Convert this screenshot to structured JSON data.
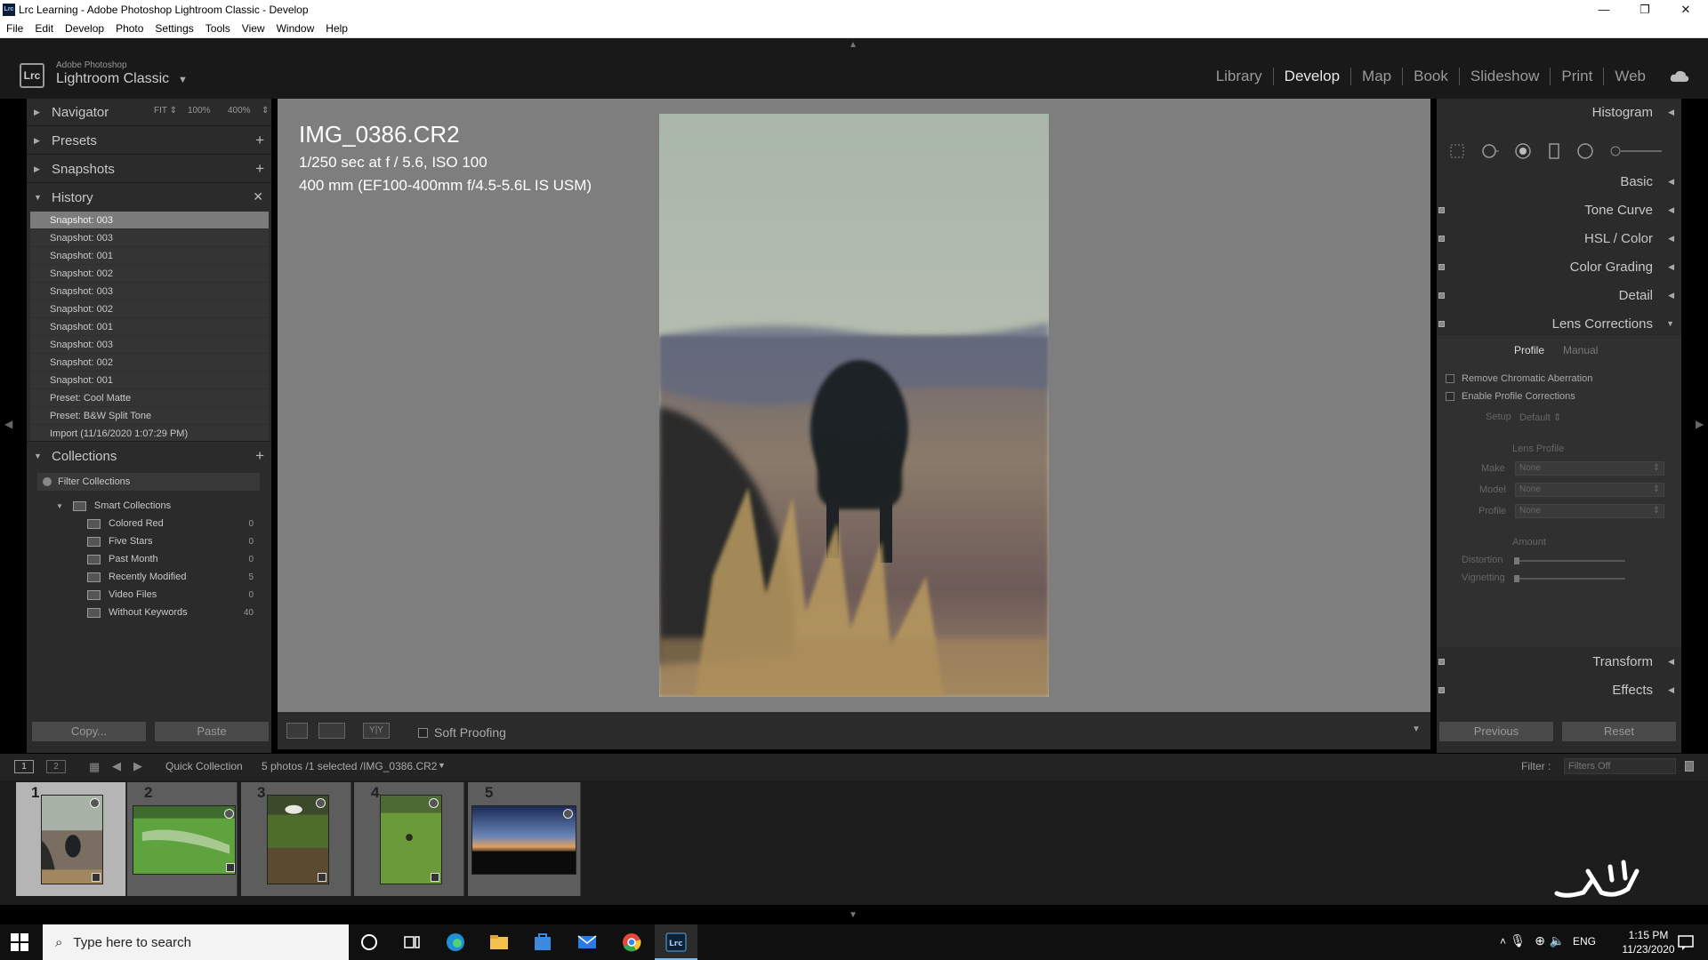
{
  "window": {
    "title": "Lrc Learning - Adobe Photoshop Lightroom Classic - Develop",
    "app_icon_text": "Lrc",
    "minimize": "—",
    "maximize": "❐",
    "close": "✕"
  },
  "menu": [
    "File",
    "Edit",
    "Develop",
    "Photo",
    "Settings",
    "Tools",
    "View",
    "Window",
    "Help"
  ],
  "brand": {
    "logo": "Lrc",
    "small": "Adobe Photoshop",
    "large": "Lightroom Classic"
  },
  "modules": [
    "Library",
    "Develop",
    "Map",
    "Book",
    "Slideshow",
    "Print",
    "Web"
  ],
  "active_module": "Develop",
  "left_panel": {
    "navigator": {
      "label": "Navigator",
      "fit": "FIT ⇕",
      "z100": "100%",
      "z400": "400%",
      "more": "⇕"
    },
    "presets": {
      "label": "Presets"
    },
    "snapshots": {
      "label": "Snapshots"
    },
    "history": {
      "label": "History",
      "items": [
        "Snapshot: 003",
        "Snapshot: 003",
        "Snapshot: 001",
        "Snapshot: 002",
        "Snapshot: 003",
        "Snapshot: 002",
        "Snapshot: 001",
        "Snapshot: 003",
        "Snapshot: 002",
        "Snapshot: 001",
        "Preset: Cool Matte",
        "Preset: B&W Split Tone",
        "Import (11/16/2020 1:07:29 PM)"
      ],
      "selected_index": 0
    },
    "collections": {
      "label": "Collections",
      "filter": "Filter Collections",
      "group": "Smart Collections",
      "items": [
        {
          "name": "Colored Red",
          "count": "0"
        },
        {
          "name": "Five Stars",
          "count": "0"
        },
        {
          "name": "Past Month",
          "count": "0"
        },
        {
          "name": "Recently Modified",
          "count": "5"
        },
        {
          "name": "Video Files",
          "count": "0"
        },
        {
          "name": "Without Keywords",
          "count": "40"
        }
      ]
    },
    "copy_button": "Copy...",
    "paste_button": "Paste"
  },
  "image_info": {
    "filename": "IMG_0386.CR2",
    "exposure": "1/250 sec at f / 5.6, ISO 100",
    "lens": "400 mm (EF100-400mm f/4.5-5.6L IS USM)"
  },
  "toolbar": {
    "soft_proofing": "Soft Proofing",
    "yy": "Y|Y"
  },
  "right_panel": {
    "histogram": "Histogram",
    "sections": [
      "Basic",
      "Tone Curve",
      "HSL / Color",
      "Color Grading",
      "Detail",
      "Lens Corrections",
      "Transform",
      "Effects"
    ],
    "lens": {
      "tab_profile": "Profile",
      "tab_manual": "Manual",
      "remove_ca": "Remove Chromatic Aberration",
      "enable_profile": "Enable Profile Corrections",
      "setup_label": "Setup",
      "setup_value": "Default ⇕",
      "lens_profile": "Lens Profile",
      "make_label": "Make",
      "model_label": "Model",
      "profile_label": "Profile",
      "none": "None",
      "amount": "Amount",
      "distortion": "Distortion",
      "vignetting": "Vignetting"
    },
    "previous_button": "Previous",
    "reset_button": "Reset"
  },
  "filmstrip": {
    "screen1": "1",
    "screen2": "2",
    "source": "Quick Collection",
    "info": "5 photos /1 selected /IMG_0386.CR2",
    "info_arrow": "▼",
    "filter_label": "Filter :",
    "filter_value": "Filters Off",
    "thumbs": [
      "1",
      "2",
      "3",
      "4",
      "5"
    ]
  },
  "taskbar": {
    "search_placeholder": "Type here to search",
    "lang": "ENG",
    "time": "1:15 PM",
    "date": "11/23/2020"
  },
  "colors": {
    "panel": "#2b2b2b",
    "center": "#7e7e7e",
    "selected_history": "#7b7b7b",
    "taskbar": "#101010"
  }
}
